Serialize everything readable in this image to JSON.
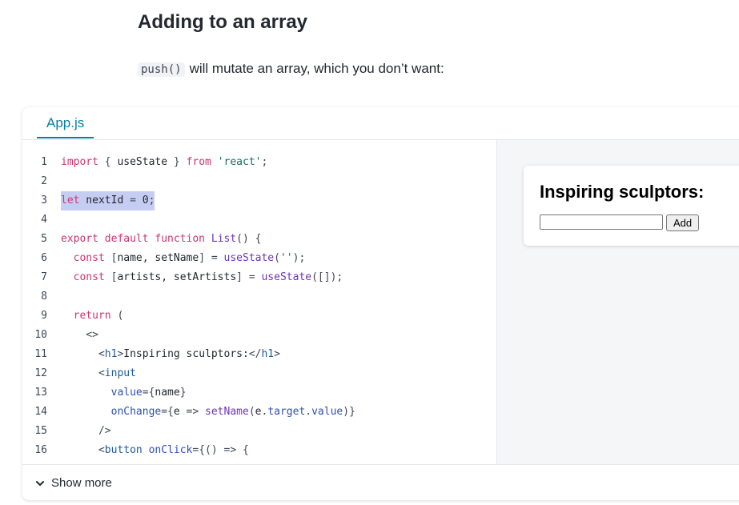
{
  "heading": "Adding to an array",
  "intro": {
    "code": "push()",
    "text": "will mutate an array, which you don’t want:"
  },
  "tab": {
    "label": "App.js"
  },
  "code": {
    "lines": [
      {
        "n": "1",
        "parts": [
          [
            "k",
            "import"
          ],
          [
            "p",
            " { "
          ],
          [
            "",
            "useState"
          ],
          [
            "p",
            " } "
          ],
          [
            "k",
            "from"
          ],
          [
            "s",
            " 'react'"
          ],
          [
            "p",
            ";"
          ]
        ]
      },
      {
        "n": "2",
        "parts": []
      },
      {
        "n": "3",
        "highlight": true,
        "parts": [
          [
            "k",
            "let"
          ],
          [
            "",
            " nextId "
          ],
          [
            "p",
            "="
          ],
          [
            "",
            " 0"
          ],
          [
            "p",
            ";"
          ]
        ]
      },
      {
        "n": "4",
        "parts": []
      },
      {
        "n": "5",
        "parts": [
          [
            "k",
            "export default function "
          ],
          [
            "f",
            "List"
          ],
          [
            "p",
            "() {"
          ]
        ]
      },
      {
        "n": "6",
        "parts": [
          [
            "k",
            "  const "
          ],
          [
            "p",
            "["
          ],
          [
            "",
            "name, setName"
          ],
          [
            "p",
            "] = "
          ],
          [
            "f",
            "useState"
          ],
          [
            "p",
            "("
          ],
          [
            "s",
            "''"
          ],
          [
            "p",
            ");"
          ]
        ]
      },
      {
        "n": "7",
        "parts": [
          [
            "k",
            "  const "
          ],
          [
            "p",
            "["
          ],
          [
            "",
            "artists, setArtists"
          ],
          [
            "p",
            "] = "
          ],
          [
            "f",
            "useState"
          ],
          [
            "p",
            "([]);"
          ]
        ]
      },
      {
        "n": "8",
        "parts": []
      },
      {
        "n": "9",
        "parts": [
          [
            "k",
            "  return "
          ],
          [
            "p",
            "("
          ]
        ]
      },
      {
        "n": "10",
        "parts": [
          [
            "p",
            "    <>"
          ]
        ]
      },
      {
        "n": "11",
        "parts": [
          [
            "p",
            "      <"
          ],
          [
            "tg",
            "h1"
          ],
          [
            "p",
            ">"
          ],
          [
            "",
            "Inspiring sculptors:"
          ],
          [
            "p",
            "</"
          ],
          [
            "tg",
            "h1"
          ],
          [
            "p",
            ">"
          ]
        ]
      },
      {
        "n": "12",
        "parts": [
          [
            "p",
            "      <"
          ],
          [
            "tg",
            "input"
          ]
        ]
      },
      {
        "n": "13",
        "parts": [
          [
            "a",
            "        value"
          ],
          [
            "p",
            "={"
          ],
          [
            "",
            "name"
          ],
          [
            "p",
            "}"
          ]
        ]
      },
      {
        "n": "14",
        "parts": [
          [
            "a",
            "        onChange"
          ],
          [
            "p",
            "={"
          ],
          [
            "",
            "e "
          ],
          [
            "p",
            "=> "
          ],
          [
            "f",
            "setName"
          ],
          [
            "p",
            "("
          ],
          [
            "",
            "e"
          ],
          [
            "p",
            "."
          ],
          [
            "a",
            "target"
          ],
          [
            "p",
            "."
          ],
          [
            "a",
            "value"
          ],
          [
            "p",
            ")}"
          ]
        ]
      },
      {
        "n": "15",
        "parts": [
          [
            "p",
            "      />"
          ]
        ]
      },
      {
        "n": "16",
        "parts": [
          [
            "p",
            "      <"
          ],
          [
            "tg",
            "button "
          ],
          [
            "a",
            "onClick"
          ],
          [
            "p",
            "={() => {"
          ]
        ]
      }
    ]
  },
  "preview": {
    "heading": "Inspiring sculptors:",
    "input_value": "",
    "button_label": "Add"
  },
  "footer": {
    "show_more_label": "Show more"
  }
}
